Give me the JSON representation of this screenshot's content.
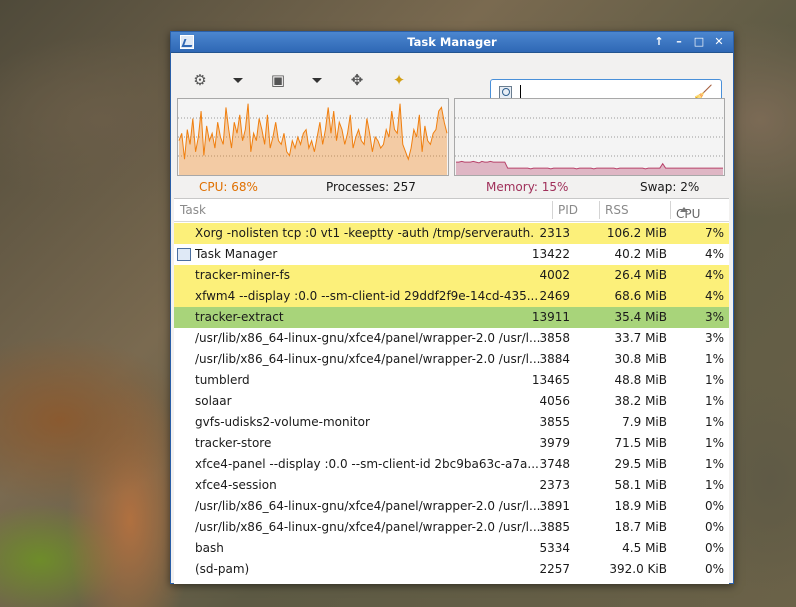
{
  "window": {
    "title": "Task Manager",
    "controls": [
      "↑",
      "–",
      "□",
      "✕"
    ]
  },
  "toolbar": {
    "search_value": ""
  },
  "stats": {
    "cpu": "CPU: 68%",
    "processes": "Processes: 257",
    "memory": "Memory: 15%",
    "swap": "Swap: 2%"
  },
  "colors": {
    "cpu": "#f07f0f",
    "memory": "#b8436b",
    "highlight_new": "#fcf07a",
    "highlight_selected": "#a8d47a",
    "titlebar": "#2f68b5"
  },
  "table": {
    "columns": {
      "task": "Task",
      "pid": "PID",
      "rss": "RSS",
      "cpu": "CPU"
    },
    "sort_column": "cpu",
    "rows": [
      {
        "task": "Xorg -nolisten tcp :0 vt1 -keeptty -auth /tmp/serverauth.",
        "pid": "2313",
        "rss": "106.2 MiB",
        "cpu": "7%",
        "highlight": "yellow",
        "icon": false
      },
      {
        "task": "Task Manager",
        "pid": "13422",
        "rss": "40.2 MiB",
        "cpu": "4%",
        "highlight": "",
        "icon": true
      },
      {
        "task": "tracker-miner-fs",
        "pid": "4002",
        "rss": "26.4 MiB",
        "cpu": "4%",
        "highlight": "yellow",
        "icon": false
      },
      {
        "task": "xfwm4 --display :0.0 --sm-client-id 29ddf2f9e-14cd-435...",
        "pid": "2469",
        "rss": "68.6 MiB",
        "cpu": "4%",
        "highlight": "yellow",
        "icon": false
      },
      {
        "task": "tracker-extract",
        "pid": "13911",
        "rss": "35.4 MiB",
        "cpu": "3%",
        "highlight": "green",
        "icon": false
      },
      {
        "task": "/usr/lib/x86_64-linux-gnu/xfce4/panel/wrapper-2.0 /usr/l...",
        "pid": "3858",
        "rss": "33.7 MiB",
        "cpu": "3%",
        "highlight": "",
        "icon": false
      },
      {
        "task": "/usr/lib/x86_64-linux-gnu/xfce4/panel/wrapper-2.0 /usr/l...",
        "pid": "3884",
        "rss": "30.8 MiB",
        "cpu": "1%",
        "highlight": "",
        "icon": false
      },
      {
        "task": "tumblerd",
        "pid": "13465",
        "rss": "48.8 MiB",
        "cpu": "1%",
        "highlight": "",
        "icon": false
      },
      {
        "task": "solaar",
        "pid": "4056",
        "rss": "38.2 MiB",
        "cpu": "1%",
        "highlight": "",
        "icon": false
      },
      {
        "task": "gvfs-udisks2-volume-monitor",
        "pid": "3855",
        "rss": "7.9 MiB",
        "cpu": "1%",
        "highlight": "",
        "icon": false
      },
      {
        "task": "tracker-store",
        "pid": "3979",
        "rss": "71.5 MiB",
        "cpu": "1%",
        "highlight": "",
        "icon": false
      },
      {
        "task": "xfce4-panel --display :0.0 --sm-client-id 2bc9ba63c-a7a...",
        "pid": "3748",
        "rss": "29.5 MiB",
        "cpu": "1%",
        "highlight": "",
        "icon": false
      },
      {
        "task": "xfce4-session",
        "pid": "2373",
        "rss": "58.1 MiB",
        "cpu": "1%",
        "highlight": "",
        "icon": false
      },
      {
        "task": "/usr/lib/x86_64-linux-gnu/xfce4/panel/wrapper-2.0 /usr/l...",
        "pid": "3891",
        "rss": "18.9 MiB",
        "cpu": "0%",
        "highlight": "",
        "icon": false
      },
      {
        "task": "/usr/lib/x86_64-linux-gnu/xfce4/panel/wrapper-2.0 /usr/l...",
        "pid": "3885",
        "rss": "18.7 MiB",
        "cpu": "0%",
        "highlight": "",
        "icon": false
      },
      {
        "task": "bash",
        "pid": "5334",
        "rss": "4.5 MiB",
        "cpu": "0%",
        "highlight": "",
        "icon": false
      },
      {
        "task": "(sd-pam)",
        "pid": "2257",
        "rss": "392.0 KiB",
        "cpu": "0%",
        "highlight": "",
        "icon": false
      }
    ]
  },
  "chart_data": [
    {
      "type": "area",
      "series": [
        {
          "values": [
            45,
            55,
            20,
            60,
            40,
            75,
            30,
            50,
            85,
            25,
            65,
            45,
            55,
            35,
            70,
            50,
            40,
            90,
            60,
            35,
            70,
            55,
            80,
            45,
            60,
            95,
            30,
            55,
            45,
            75,
            60,
            40,
            80,
            35,
            50,
            70,
            45,
            40,
            55,
            30,
            25,
            45,
            35,
            50,
            40,
            55,
            60,
            35,
            45,
            30,
            50,
            70,
            40,
            60,
            90,
            55,
            85,
            45,
            70,
            60,
            40,
            55,
            80,
            35,
            50,
            60,
            45,
            40,
            75,
            55,
            30,
            50,
            45,
            35,
            40,
            60,
            50,
            85,
            60,
            55,
            95,
            40,
            30,
            20,
            35,
            60,
            50,
            80,
            30,
            65,
            45,
            40,
            55,
            60,
            85,
            90,
            70,
            55
          ]
        }
      ],
      "ylim": [
        0,
        100
      ]
    },
    {
      "type": "area",
      "series": [
        {
          "values": [
            16,
            16,
            17,
            16,
            16,
            16,
            17,
            16,
            15,
            17,
            16,
            16,
            17,
            16,
            16,
            16,
            16,
            16,
            8,
            8,
            8,
            8,
            8,
            8,
            8,
            8,
            7,
            8,
            8,
            8,
            8,
            8,
            8,
            7,
            8,
            8,
            8,
            8,
            8,
            8,
            8,
            8,
            7,
            8,
            8,
            8,
            8,
            8,
            7,
            8,
            8,
            8,
            8,
            8,
            8,
            8,
            7,
            8,
            8,
            8,
            8,
            8,
            8,
            8,
            8,
            8,
            7,
            8,
            8,
            8,
            8,
            8,
            14,
            8,
            8,
            8,
            8,
            8,
            8,
            8,
            8,
            8,
            8,
            8,
            8,
            8,
            8,
            8,
            8,
            8,
            8,
            8,
            8,
            8
          ]
        }
      ],
      "ylim": [
        0,
        100
      ]
    }
  ]
}
